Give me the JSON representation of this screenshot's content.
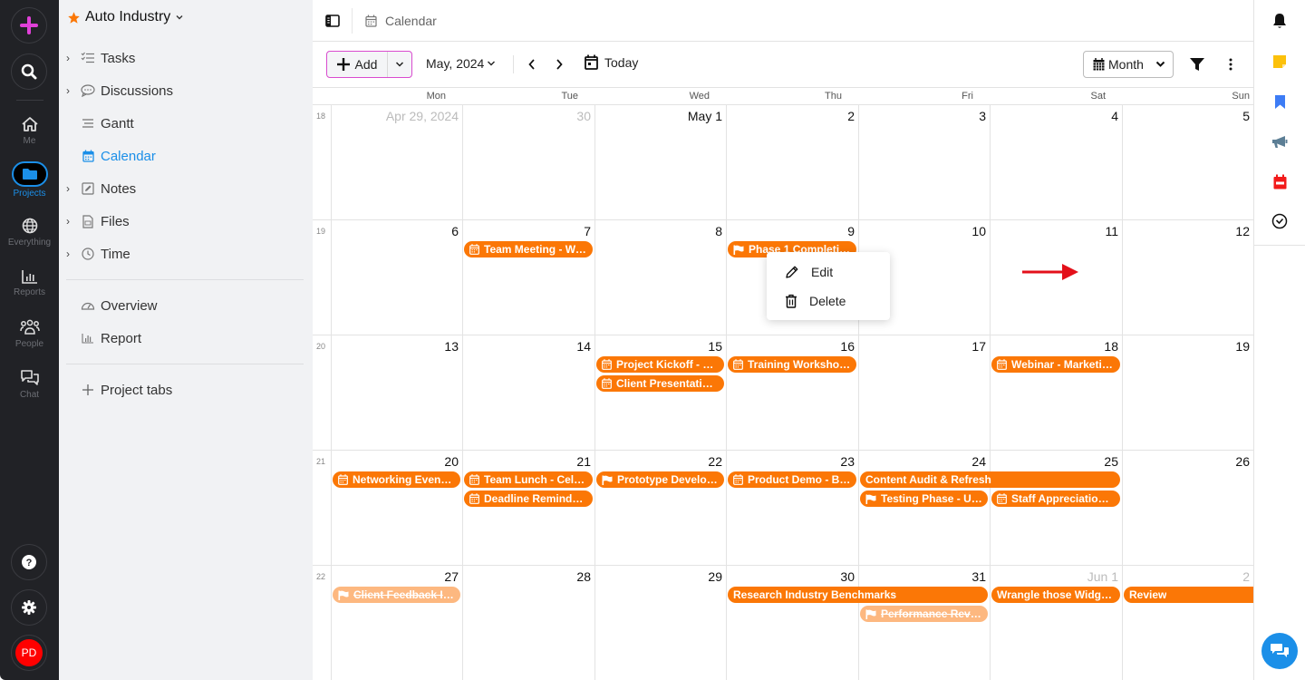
{
  "rail": {
    "items": [
      {
        "label": "Me"
      },
      {
        "label": "Projects"
      },
      {
        "label": "Everything"
      },
      {
        "label": "Reports"
      },
      {
        "label": "People"
      },
      {
        "label": "Chat"
      }
    ],
    "avatar_initials": "PD"
  },
  "sidebar": {
    "project_name": "Auto Industry",
    "items": [
      {
        "label": "Tasks"
      },
      {
        "label": "Discussions"
      },
      {
        "label": "Gantt"
      },
      {
        "label": "Calendar"
      },
      {
        "label": "Notes"
      },
      {
        "label": "Files"
      },
      {
        "label": "Time"
      },
      {
        "label": "Overview"
      },
      {
        "label": "Report"
      }
    ],
    "add_tabs_label": "Project tabs"
  },
  "topbar": {
    "title": "Calendar"
  },
  "toolbar": {
    "add_label": "Add",
    "month_label": "May, 2024",
    "today_label": "Today",
    "view_label": "Month"
  },
  "calendar": {
    "weekdays": [
      "Mon",
      "Tue",
      "Wed",
      "Thu",
      "Fri",
      "Sat",
      "Sun"
    ],
    "weeks": [
      {
        "num": "18",
        "days": [
          "Apr 29, 2024",
          "30",
          "May 1",
          "2",
          "3",
          "4",
          "5"
        ]
      },
      {
        "num": "19",
        "days": [
          "6",
          "7",
          "8",
          "9",
          "10",
          "11",
          "12"
        ]
      },
      {
        "num": "20",
        "days": [
          "13",
          "14",
          "15",
          "16",
          "17",
          "18",
          "19"
        ]
      },
      {
        "num": "21",
        "days": [
          "20",
          "21",
          "22",
          "23",
          "24",
          "25",
          "26"
        ]
      },
      {
        "num": "22",
        "days": [
          "27",
          "28",
          "29",
          "30",
          "31",
          "Jun 1",
          "2"
        ]
      }
    ],
    "events": [
      {
        "title": "Team Meeting - Wee…",
        "icon": "calendar"
      },
      {
        "title": "Phase 1 Completio…",
        "icon": "flag"
      },
      {
        "title": "Project Kickoff - Pla…",
        "icon": "calendar"
      },
      {
        "title": "Client Presentation -…",
        "icon": "calendar"
      },
      {
        "title": "Training Workshop - …",
        "icon": "calendar"
      },
      {
        "title": "Webinar - Marketing …",
        "icon": "calendar"
      },
      {
        "title": "Networking Event - I…",
        "icon": "calendar"
      },
      {
        "title": "Team Lunch - Celebr…",
        "icon": "calendar"
      },
      {
        "title": "Deadline Reminder - …",
        "icon": "calendar"
      },
      {
        "title": "Prototype Develop…",
        "icon": "flag"
      },
      {
        "title": "Product Demo - Beta…",
        "icon": "calendar"
      },
      {
        "title": "Content Audit & Refresh",
        "icon": "none"
      },
      {
        "title": "Testing Phase - Us…",
        "icon": "flag"
      },
      {
        "title": "Staff Appreciation D…",
        "icon": "calendar"
      },
      {
        "title": "Client Feedback Inc…",
        "icon": "flag",
        "status": "completed"
      },
      {
        "title": "Research Industry Benchmarks",
        "icon": "none"
      },
      {
        "title": "Performance Revie…",
        "icon": "flag",
        "status": "completed"
      },
      {
        "title": "Wrangle those Widgets…",
        "icon": "none"
      },
      {
        "title": "Review",
        "icon": "none"
      }
    ]
  },
  "context_menu": {
    "edit_label": "Edit",
    "delete_label": "Delete"
  },
  "colors": {
    "event": "#fb7706",
    "event_completed": "#fdb880",
    "accent": "#1b8fe8",
    "add_border": "#d94ccf"
  }
}
